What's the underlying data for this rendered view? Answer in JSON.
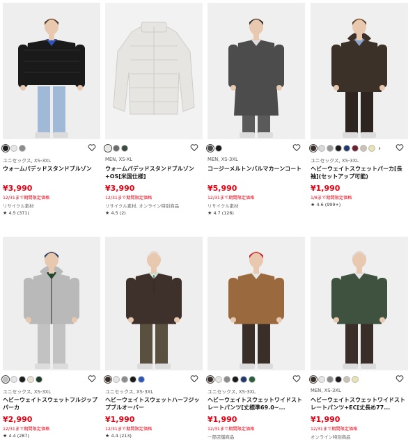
{
  "colors": {
    "price_red": "#e60012",
    "heart_stroke": "#333333"
  },
  "icons": {
    "heart": "heart-outline-icon",
    "star": "star-icon",
    "more": "chevron-right-icon"
  },
  "products": [
    {
      "category": "ユニセックス, XS-3XL",
      "name": "ウォームパデッドスタンドブルゾン",
      "price": "¥3,990",
      "promo": "12/31まで期間限定価格",
      "note": "リサイクル素材",
      "rating": "4.5",
      "reviews": "(371)",
      "swatches": [
        "#1e1e1e",
        "#e6e6e6",
        "#8c8c8c"
      ],
      "photo": {
        "bg": "#eeeeee",
        "garment": "#1a1a1a",
        "under": "#2e56b8",
        "pants": "#9fb9d6",
        "hair": "#4a3422",
        "shape": "puffer"
      }
    },
    {
      "category": "MEN, XS-XL",
      "name": "ウォームパデッドスタンドブルゾン+OS[米国仕様]",
      "price": "¥3,990",
      "promo": "12/31まで期間限定価格",
      "note": "リサイクル素材, オンライン特別商品",
      "rating": "4.5",
      "reviews": "(2)",
      "swatches": [
        "#e8e6e2",
        "#6c6c6c",
        "#3a4a3e"
      ],
      "photo": {
        "bg": "#f2f2f2",
        "garment": "#e7e5e1",
        "shape": "flat-puffer"
      }
    },
    {
      "category": "MEN, XS-3XL",
      "name": "コージーメルトンバルマカーンコート",
      "price": "¥5,990",
      "promo": "12/31まで期間限定価格",
      "note": "リサイクル素材",
      "rating": "4.7",
      "reviews": "(126)",
      "swatches": [
        "#4a4a4a",
        "#1a1a1a"
      ],
      "photo": {
        "bg": "#efefef",
        "garment": "#4c4c4c",
        "under": "#dcdcdc",
        "pants": "#5a5a5a",
        "hair": "#2a2a2a",
        "shape": "coat"
      }
    },
    {
      "category": "ユニセックス, XS-3XL",
      "name": "ヘビーウェイトスウェットパーカ[長袖](セットアップ可能)",
      "price": "¥1,990",
      "promo": "1/8まで期間限定価格",
      "note": "",
      "rating": "4.6",
      "reviews": "(999+)",
      "swatches": [
        "#3a2f28",
        "#d9d9d9",
        "#9a9a9a",
        "#1c1c1c",
        "#223a6e",
        "#6e2230",
        "#c9c2b5",
        "#e8e3b0"
      ],
      "photo": {
        "bg": "#efefef",
        "garment": "#3c3129",
        "under": "#8aa6cf",
        "pants": "#2e2420",
        "hair": "#5a3e28",
        "shape": "hoodie"
      }
    },
    {
      "category": "ユニセックス, XS-3XL",
      "name": "ヘビーウェイトスウェットフルジップパーカ",
      "price": "¥2,990",
      "promo": "12/31まで期間限定価格",
      "note": "",
      "rating": "4.4",
      "reviews": "(287)",
      "swatches": [
        "#bdbdbd",
        "#e6e6e6",
        "#1e1e1e",
        "#e9e2d0",
        "#1e3a2a"
      ],
      "photo": {
        "bg": "#eeeeee",
        "garment": "#b9b9b9",
        "under": "#1f4a30",
        "pants": "#c2c2c2",
        "hair": "#203a6a",
        "shape": "zip-hoodie"
      }
    },
    {
      "category": "ユニセックス, XS-3XL",
      "name": "ヘビーウェイトスウェットハーフジップブルオーバー",
      "price": "¥1,990",
      "promo": "12/31まで期間限定価格",
      "note": "",
      "rating": "4.4",
      "reviews": "(213)",
      "swatches": [
        "#3a2d27",
        "#e6e6e6",
        "#8c8c8c",
        "#1a1a1a",
        "#2d56b0"
      ],
      "photo": {
        "bg": "#eeeeee",
        "garment": "#3e302a",
        "under": "#cfe6da",
        "pants": "#5a5040",
        "hair": "#e6e6e6",
        "shape": "half-zip"
      }
    },
    {
      "category": "ユニセックス, XS-3XL",
      "name": "ヘビーウェイトスウェットワイドストレートパンツ[丈標準69.0~...",
      "price": "¥1,990",
      "promo": "12/31まで期間限定価格",
      "note": "一部店舗商品",
      "rating": "",
      "reviews": "",
      "swatches": [
        "#3a2f28",
        "#e6e6e6",
        "#8c8c8c",
        "#1a1a1a",
        "#223a6e",
        "#2a5e3a"
      ],
      "photo": {
        "bg": "#efefef",
        "garment": "#9a6a3e",
        "under": "#e6e6e6",
        "pants": "#3a2e28",
        "hair": "#c8222e",
        "shape": "jacket"
      }
    },
    {
      "category": "MEN, XS-3XL",
      "name": "ヘビーウェイトスウェットワイドストレートパンツ+EC[丈長め77...",
      "price": "¥1,990",
      "promo": "12/31まで期間限定価格",
      "note": "オンライン特別商品",
      "rating": "",
      "reviews": "",
      "swatches": [
        "#3a2f28",
        "#e6e6e6",
        "#8c8c8c",
        "#1a1a1a",
        "#c9c2b5",
        "#e8e3b0"
      ],
      "photo": {
        "bg": "#efefef",
        "garment": "#3f5240",
        "under": "#e6e6e6",
        "pants": "#3a2e28",
        "hair": "#dcdcdc",
        "shape": "pullover"
      }
    }
  ]
}
